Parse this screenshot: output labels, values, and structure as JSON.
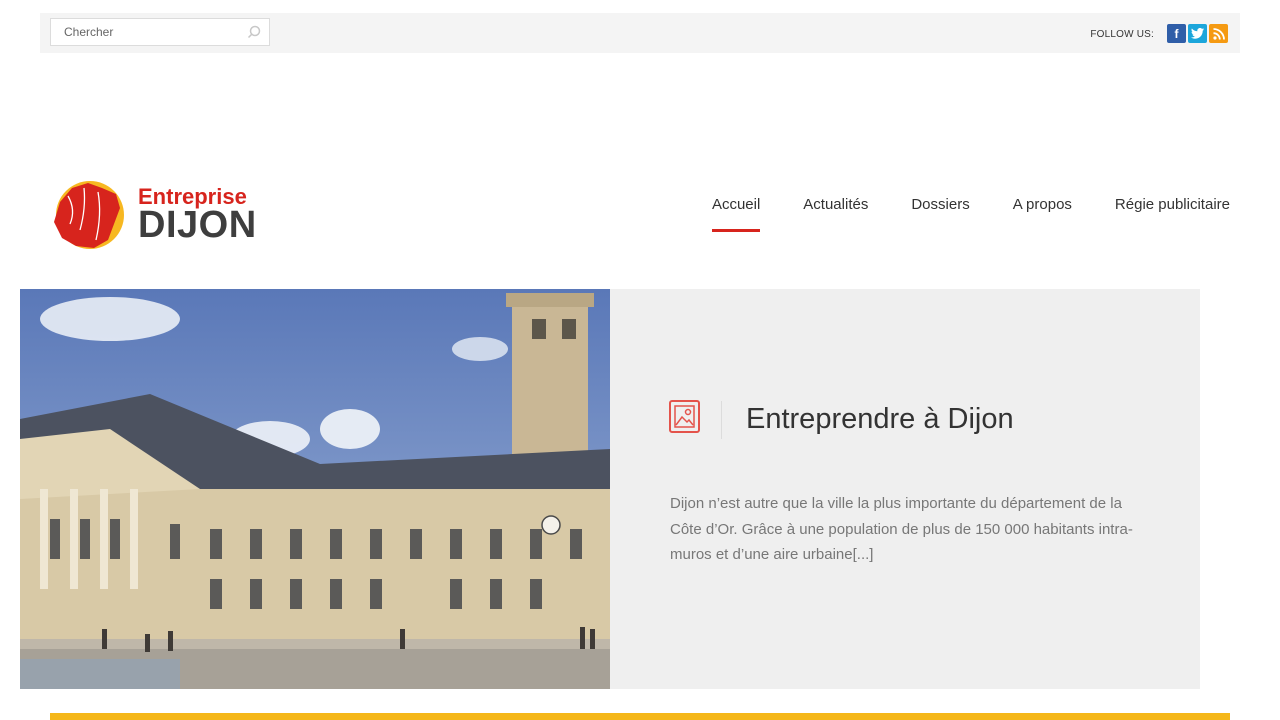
{
  "header": {
    "search": {
      "placeholder": "Chercher",
      "value": ""
    },
    "follow_label": "FOLLOW US:",
    "social": [
      {
        "name": "facebook",
        "glyph": "f",
        "color": "#2f5ea8"
      },
      {
        "name": "twitter",
        "glyph": "t",
        "color": "#1ca6db"
      },
      {
        "name": "rss",
        "glyph": "r",
        "color": "#f59a12"
      }
    ]
  },
  "logo": {
    "line1": "Entreprise",
    "line2": "DIJON"
  },
  "nav": {
    "items": [
      {
        "label": "Accueil",
        "active": true
      },
      {
        "label": "Actualités",
        "active": false
      },
      {
        "label": "Dossiers",
        "active": false
      },
      {
        "label": "A propos",
        "active": false
      },
      {
        "label": "Régie publicitaire",
        "active": false
      }
    ]
  },
  "featured": {
    "icon": "gallery-icon",
    "title": "Entreprendre à Dijon",
    "excerpt": "Dijon n’est autre que la ville la plus importante du département de la Côte d’Or. Grâce à une population de plus de 150 000 habitants intra-muros et d’une aire urbaine[...]"
  },
  "colors": {
    "accent": "#d7241d",
    "bottom_bar": "#f5b71a",
    "panel": "#efefef"
  }
}
